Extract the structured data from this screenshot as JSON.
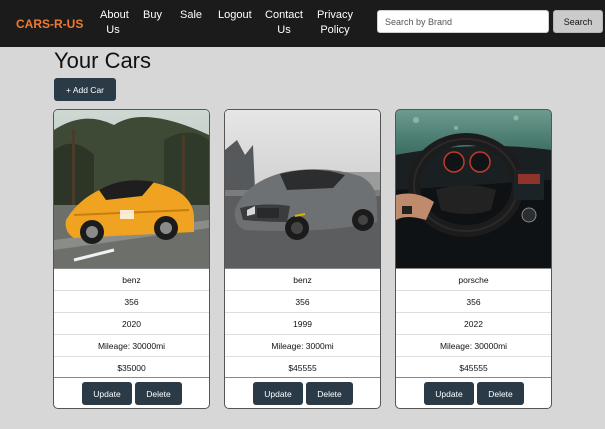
{
  "nav": {
    "brand": "CARS-R-US",
    "links": [
      {
        "label": "About Us"
      },
      {
        "label": "Buy"
      },
      {
        "label": "Sale"
      },
      {
        "label": "Logout"
      },
      {
        "label": "Contact Us"
      },
      {
        "label": "Privacy Policy"
      }
    ],
    "search_placeholder": "Search by Brand",
    "search_button": "Search"
  },
  "main": {
    "title": "Your Cars",
    "add_button": "+ Add Car"
  },
  "cars": [
    {
      "brand": "benz",
      "model": "356",
      "year": "2020",
      "mileage": "Mileage: 30000mi",
      "price": "$35000",
      "update_label": "Update",
      "delete_label": "Delete",
      "photo": "orange-sports-car-photo"
    },
    {
      "brand": "benz",
      "model": "356",
      "year": "1999",
      "mileage": "Mileage: 3000mi",
      "price": "$45555",
      "update_label": "Update",
      "delete_label": "Delete",
      "photo": "gray-mercedes-amg-photo"
    },
    {
      "brand": "porsche",
      "model": "356",
      "year": "2022",
      "mileage": "Mileage: 30000mi",
      "price": "$45555",
      "update_label": "Update",
      "delete_label": "Delete",
      "photo": "car-interior-dashboard-photo"
    }
  ],
  "colors": {
    "navbar_bg": "#1b1b1b",
    "brand_accent": "#f07a2d",
    "button_bg": "#2b3a47",
    "page_bg": "#d7d7d7"
  }
}
